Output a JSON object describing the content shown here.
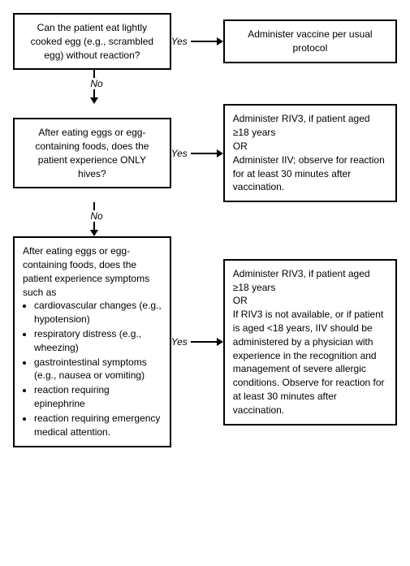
{
  "box1": {
    "text": "Can the patient eat lightly cooked egg (e.g., scrambled egg) without reaction?"
  },
  "box1_right": {
    "text": "Administer vaccine per usual protocol"
  },
  "box2": {
    "text": "After eating eggs or egg-containing foods, does the patient experience ONLY hives?"
  },
  "box2_right": {
    "lines": [
      "Administer RIV3, if patient aged ≥18 years",
      "OR",
      "Administer IIV; observe for reaction for at least 30 minutes after vaccination."
    ]
  },
  "box3": {
    "intro": "After eating eggs or egg-containing foods, does the patient experience symptoms such as",
    "bullets": [
      "cardiovascular changes (e.g., hypotension)",
      "respiratory distress (e.g., wheezing)",
      "gastrointestinal symptoms (e.g., nausea or vomiting)",
      "reaction requiring epinephrine",
      "reaction requiring emergency medical attention."
    ]
  },
  "box3_right": {
    "lines": [
      "Administer RIV3, if patient aged ≥18 years",
      "OR",
      "If RIV3 is not available, or if patient is aged <18 years, IIV should be administered by a physician with experience in the recognition and management of severe allergic conditions. Observe for reaction for at least 30 minutes after vaccination."
    ]
  },
  "labels": {
    "yes": "Yes",
    "no": "No"
  }
}
